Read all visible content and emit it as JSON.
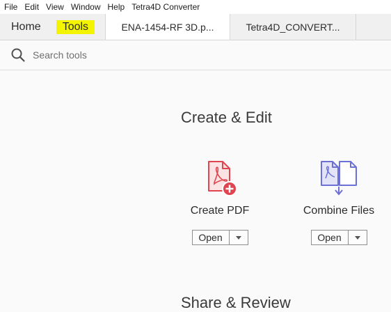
{
  "menu": [
    "File",
    "Edit",
    "View",
    "Window",
    "Help",
    "Tetra4D Converter"
  ],
  "tabs": {
    "home": "Home",
    "tools": "Tools",
    "docs": [
      "ENA-1454-RF 3D.p...",
      "Tetra4D_CONVERT..."
    ]
  },
  "search": {
    "placeholder": "Search tools"
  },
  "sections": [
    {
      "title": "Create & Edit",
      "tools": [
        {
          "label": "Create PDF",
          "open_label": "Open",
          "icon": "create-pdf-icon",
          "color": "#e0454f"
        },
        {
          "label": "Combine Files",
          "open_label": "Open",
          "icon": "combine-files-icon",
          "color": "#6b6fd6"
        }
      ]
    },
    {
      "title": "Share & Review"
    }
  ],
  "colors": {
    "highlight": "#f4f400",
    "create_pdf": "#e0454f",
    "combine": "#6b6fd6"
  }
}
